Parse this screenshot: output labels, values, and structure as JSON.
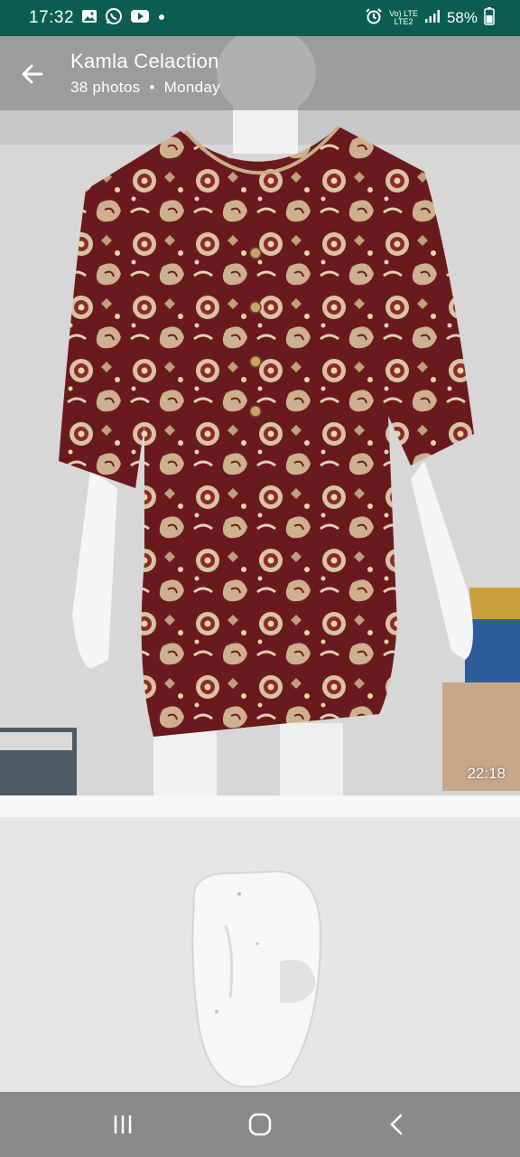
{
  "status_bar": {
    "time": "17:32",
    "network_top": "Vo) LTE",
    "network_bottom": "LTE2",
    "lte_label": "LTE",
    "battery": "58%",
    "icons": [
      "gallery-icon",
      "whatsapp-icon",
      "youtube-icon",
      "dot-icon",
      "alarm-icon",
      "signal-icon",
      "battery-icon"
    ]
  },
  "header": {
    "title": "Kamla Celaction",
    "photo_count": "38 photos",
    "separator": "•",
    "day": "Monday"
  },
  "media": {
    "first_timestamp": "22:18"
  },
  "navigation": {
    "buttons": [
      "recent-apps",
      "home",
      "back"
    ]
  },
  "colors": {
    "status_bg": "#0b5e4f",
    "header_overlay": "rgba(120,120,120,0.55)",
    "fabric_maroon": "#6a1a1f",
    "fabric_cream": "#d9c3a4",
    "nav_bg": "#8a8a8a"
  }
}
